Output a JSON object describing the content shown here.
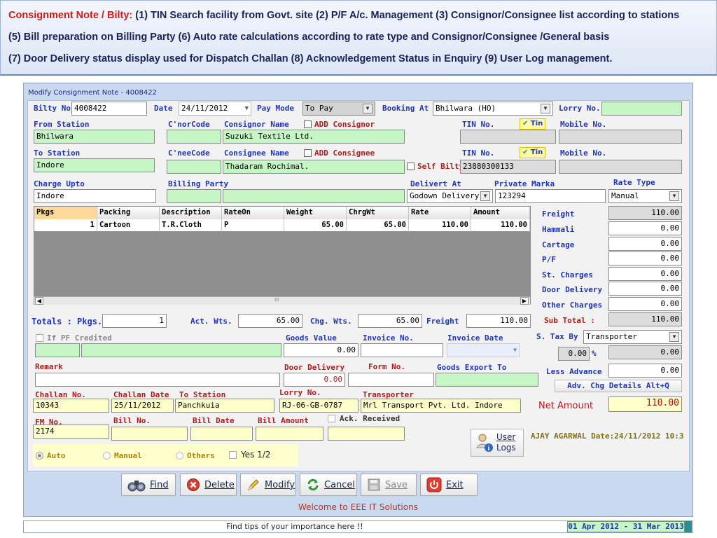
{
  "banner": {
    "prefix": "Consignment Note / Bilty:",
    "line1": "(1) TIN Search facility from Govt. site  (2) P/F A/c. Management  (3)  Consignor/Consignee list according to stations",
    "line2": "(5)  Bill preparation on Billing Party    (6) Auto rate calculations according to rate type and Consignor/Consignee /General basis",
    "line3": "(7)  Door Delivery status display used for Dispatch Challan   (8)  Acknowledgement Status in Enquiry   (9) User Log management."
  },
  "window": {
    "title": "Modify Consignment Note - 4008422"
  },
  "header": {
    "bilty_label": "Bilty No.",
    "bilty_value": "4008422",
    "date_label": "Date",
    "date_value": "24/11/2012",
    "paymode_label": "Pay Mode",
    "paymode_value": "To Pay",
    "booking_label": "Booking At",
    "booking_value": "Bhilwara (HO)",
    "lorry_label": "Lorry No.",
    "lorry_value": ""
  },
  "consignor": {
    "from_label": "From Station",
    "from_value": "Bhilwara",
    "code_label": "C'norCode",
    "code_value": "",
    "name_label": "Consignor Name",
    "add_label": "ADD Consignor",
    "name_value": "Suzuki Textile Ltd.",
    "tin_label": "TIN No.",
    "tin_badge": "Tin",
    "tin_value": "",
    "mobile_label": "Mobile No.",
    "mobile_value": ""
  },
  "consignee": {
    "to_label": "To Station",
    "to_value": "Indore",
    "code_label": "C'neeCode",
    "code_value": "",
    "name_label": "Consignee Name",
    "add_label": "ADD Consignee",
    "name_value": "Thadaram Rochimal.",
    "self_bilty_label": "Self Bilty",
    "tin_label": "TIN No.",
    "tin_badge": "Tin",
    "tin_value": "23880300133",
    "mobile_label": "Mobile No.",
    "mobile_value": ""
  },
  "charge": {
    "upto_label": "Charge Upto",
    "upto_value": "Indore",
    "billing_label": "Billing Party",
    "billing_code": "",
    "billing_name": "",
    "delivert_label": "Delivert At",
    "delivert_value": "Godown Delivery",
    "marka_label": "Private Marka",
    "marka_value": "123294",
    "ratetype_label": "Rate Type",
    "ratetype_value": "Manual"
  },
  "grid": {
    "columns": [
      "Pkgs",
      "Packing",
      "Description",
      "RateOn",
      "Weight",
      "ChrgWt",
      "Rate",
      "Amount"
    ],
    "rows": [
      {
        "pkgs": "1",
        "packing": "Cartoon",
        "description": "T.R.Cloth",
        "rateon": "P",
        "weight": "65.00",
        "chrgwt": "65.00",
        "rate": "110.00",
        "amount": "110.00"
      }
    ],
    "scroll_mid": "III"
  },
  "charges": {
    "freight_label": "Freight",
    "freight_value": "110.00",
    "hammali_label": "Hammali",
    "hammali_value": "0.00",
    "cartage_label": "Cartage",
    "cartage_value": "0.00",
    "pf_label": "P/F",
    "pf_value": "0.00",
    "st_label": "St. Charges",
    "st_value": "0.00",
    "door_label": "Door Delivery",
    "door_value": "0.00",
    "other_label": "Other Charges",
    "other_value": "0.00",
    "subtotal_label": "Sub Total :",
    "subtotal_value": "110.00",
    "stax_label": "S. Tax By",
    "stax_value": "Transporter",
    "stax_pct": "0.00",
    "pct_sign": "%",
    "stax_amount": "0.00",
    "advance_label": "Less Advance",
    "advance_value": "0.00",
    "adv_button": "Adv. Chg Details Alt+Q",
    "net_label": "Net Amount",
    "net_value": "110.00"
  },
  "totals": {
    "label": "Totals : Pkgs.",
    "pkgs": "1",
    "actwt_label": "Act. Wts.",
    "actwt": "65.00",
    "chgwt_label": "Chg. Wts.",
    "chgwt": "65.00",
    "freight_label": "Freight",
    "freight": "110.00"
  },
  "details": {
    "pf_label": "If PF Credited",
    "goods_label": "Goods Value",
    "goods_value": "0.00",
    "invoice_label": "Invoice No.",
    "invoice_value": "",
    "invdate_label": "Invoice Date",
    "remark_label": "Remark",
    "remark_value": "",
    "door_label": "Door Delivery",
    "door_value": "0.00",
    "form_label": "Form No.",
    "form_value": "",
    "export_label": "Goods Export To",
    "export_value": ""
  },
  "challan": {
    "no_label": "Challan No.",
    "no_value": "10343",
    "date_label": "Challan Date",
    "date_value": "25/11/2012",
    "station_label": "To Station",
    "station_value": "Panchkuia",
    "lorry_label": "Lorry No.",
    "lorry_value": "RJ-06-GB-0787",
    "transporter_label": "Transporter",
    "transporter_value": "Mrl Transport Pvt. Ltd.  Indore"
  },
  "bill": {
    "fm_label": "FM No.",
    "fm_value": "2174",
    "no_label": "Bill No.",
    "no_value": "",
    "date_label": "Bill Date",
    "date_value": "",
    "amount_label": "Bill Amount",
    "amount_value": "",
    "ack_label": "Ack. Received",
    "ack_value": ""
  },
  "mode": {
    "auto": "Auto",
    "manual": "Manual",
    "others": "Others",
    "yes": "Yes 1/2"
  },
  "userlogs": {
    "line1": "User",
    "line2": "Logs"
  },
  "user_info": "AJAY AGARWAL Date:24/11/2012 10:3",
  "buttons": {
    "find": "Find",
    "delete": "Delete",
    "modify": "Modify",
    "cancel": "Cancel",
    "save": "Save",
    "exit": "Exit"
  },
  "status": {
    "welcome": "Welcome to EEE IT Solutions",
    "tips": "Find tips of your importance here !!",
    "year": "01 Apr 2012 - 31 Mar 2013"
  }
}
